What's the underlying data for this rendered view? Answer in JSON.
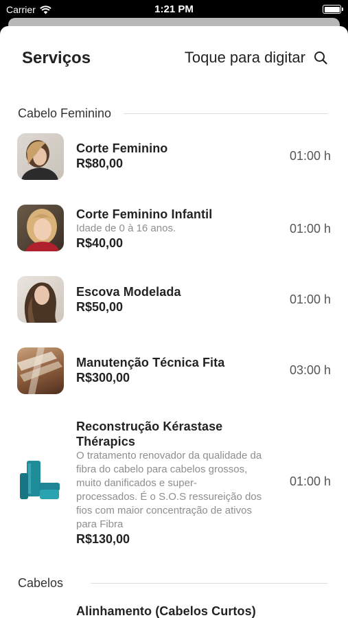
{
  "status_bar": {
    "carrier": "Carrier",
    "time": "1:21 PM"
  },
  "header": {
    "title": "Serviços",
    "search_label": "Toque para digitar"
  },
  "sections": [
    {
      "title": "Cabelo Feminino",
      "items": [
        {
          "title": "Corte Feminino",
          "price": "R$80,00",
          "duration": "01:00 h"
        },
        {
          "title": "Corte Feminino Infantil",
          "description": "Idade de 0 à 16 anos.",
          "price": "R$40,00",
          "duration": "01:00 h"
        },
        {
          "title": "Escova Modelada",
          "price": "R$50,00",
          "duration": "01:00 h"
        },
        {
          "title": "Manutenção Técnica Fita",
          "price": "R$300,00",
          "duration": "03:00 h"
        },
        {
          "title_line1": "Reconstrução Kérastase",
          "title_line2": "Thérapics",
          "description_lines": [
            "O tratamento renovador da qualidade da",
            "fibra do cabelo para cabelos grossos,",
            "muito danificados e super-",
            "processados. É o S.O.S ressureição dos",
            "fios com maior concentração de ativos",
            "para Fibra"
          ],
          "price": "R$130,00",
          "duration": "01:00 h"
        }
      ]
    },
    {
      "title": "Cabelos",
      "items": [
        {
          "title": "Alinhamento (Cabelos Curtos)"
        }
      ]
    }
  ],
  "colors": {
    "text": "#222222",
    "muted": "#8e8e8e",
    "divider": "#dddddd",
    "background": "#ffffff"
  }
}
